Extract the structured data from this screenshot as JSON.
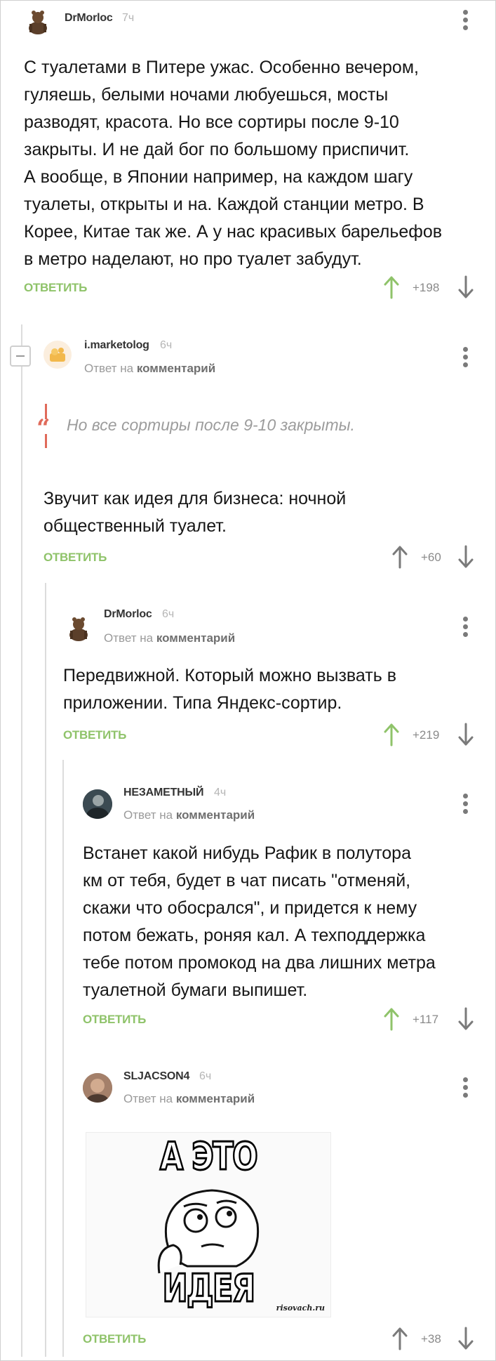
{
  "comments": [
    {
      "author": "DrMorloc",
      "time": "7ч",
      "text": [
        "С туалетами в Питере ужас. Особенно вечером,",
        "гуляешь, белыми ночами любуешься, мосты",
        "разводят, красота. Но все сортиры после 9-10",
        "закрыты. И не дай бог по большому приспичит.",
        "А вообще, в Японии например, на каждом шагу",
        "туалеты, открыты и на. Каждой станции метро. В",
        "Корее, Китае так же. А у нас красивых барельефов",
        "в метро наделают, но про туалет забудут."
      ],
      "reply_label": "ОТВЕТИТЬ",
      "score": "+198"
    },
    {
      "author": "i.marketolog",
      "time": "6ч",
      "subline_prefix": "Ответ на",
      "subline_link": "комментарий",
      "quote": "Но все сортиры после 9-10 закрыты.",
      "text": [
        "Звучит как идея для бизнеса: ночной",
        "общественный туалет."
      ],
      "reply_label": "ОТВЕТИТЬ",
      "score": "+60"
    },
    {
      "author": "DrMorloc",
      "time": "6ч",
      "subline_prefix": "Ответ на",
      "subline_link": "комментарий",
      "text": [
        "Передвижной. Который можно вызвать в",
        "приложении. Типа Яндекс-сортир."
      ],
      "reply_label": "ОТВЕТИТЬ",
      "score": "+219"
    },
    {
      "author": "НЕЗАМЕТНЫЙ",
      "time": "4ч",
      "subline_prefix": "Ответ на",
      "subline_link": "комментарий",
      "text": [
        "Встанет какой нибудь Рафик в полутора",
        "км от тебя, будет в чат писать \"отменяй,",
        "скажи что обосрался\", и придется к нему",
        "потом бежать, роняя кал. А техподдержка",
        "тебе потом промокод на два лишних метра",
        "туалетной бумаги выпишет."
      ],
      "reply_label": "ОТВЕТИТЬ",
      "score": "+117"
    },
    {
      "author": "SLJACSON4",
      "time": "6ч",
      "subline_prefix": "Ответ на",
      "subline_link": "комментарий",
      "meme_top": "А ЭТО",
      "meme_bottom": "ИДЕЯ",
      "meme_watermark": "risovach.ru",
      "reply_label": "ОТВЕТИТЬ",
      "score": "+38"
    }
  ],
  "colors": {
    "accent_green": "#8fc36a",
    "quote_red": "#e06a5a",
    "muted": "#9a9a9a"
  },
  "icons": {
    "upvote": "arrow-up-icon",
    "downvote": "arrow-down-icon",
    "more": "more-vertical-icon",
    "collapse": "minus-icon",
    "quote": "quote-icon"
  }
}
